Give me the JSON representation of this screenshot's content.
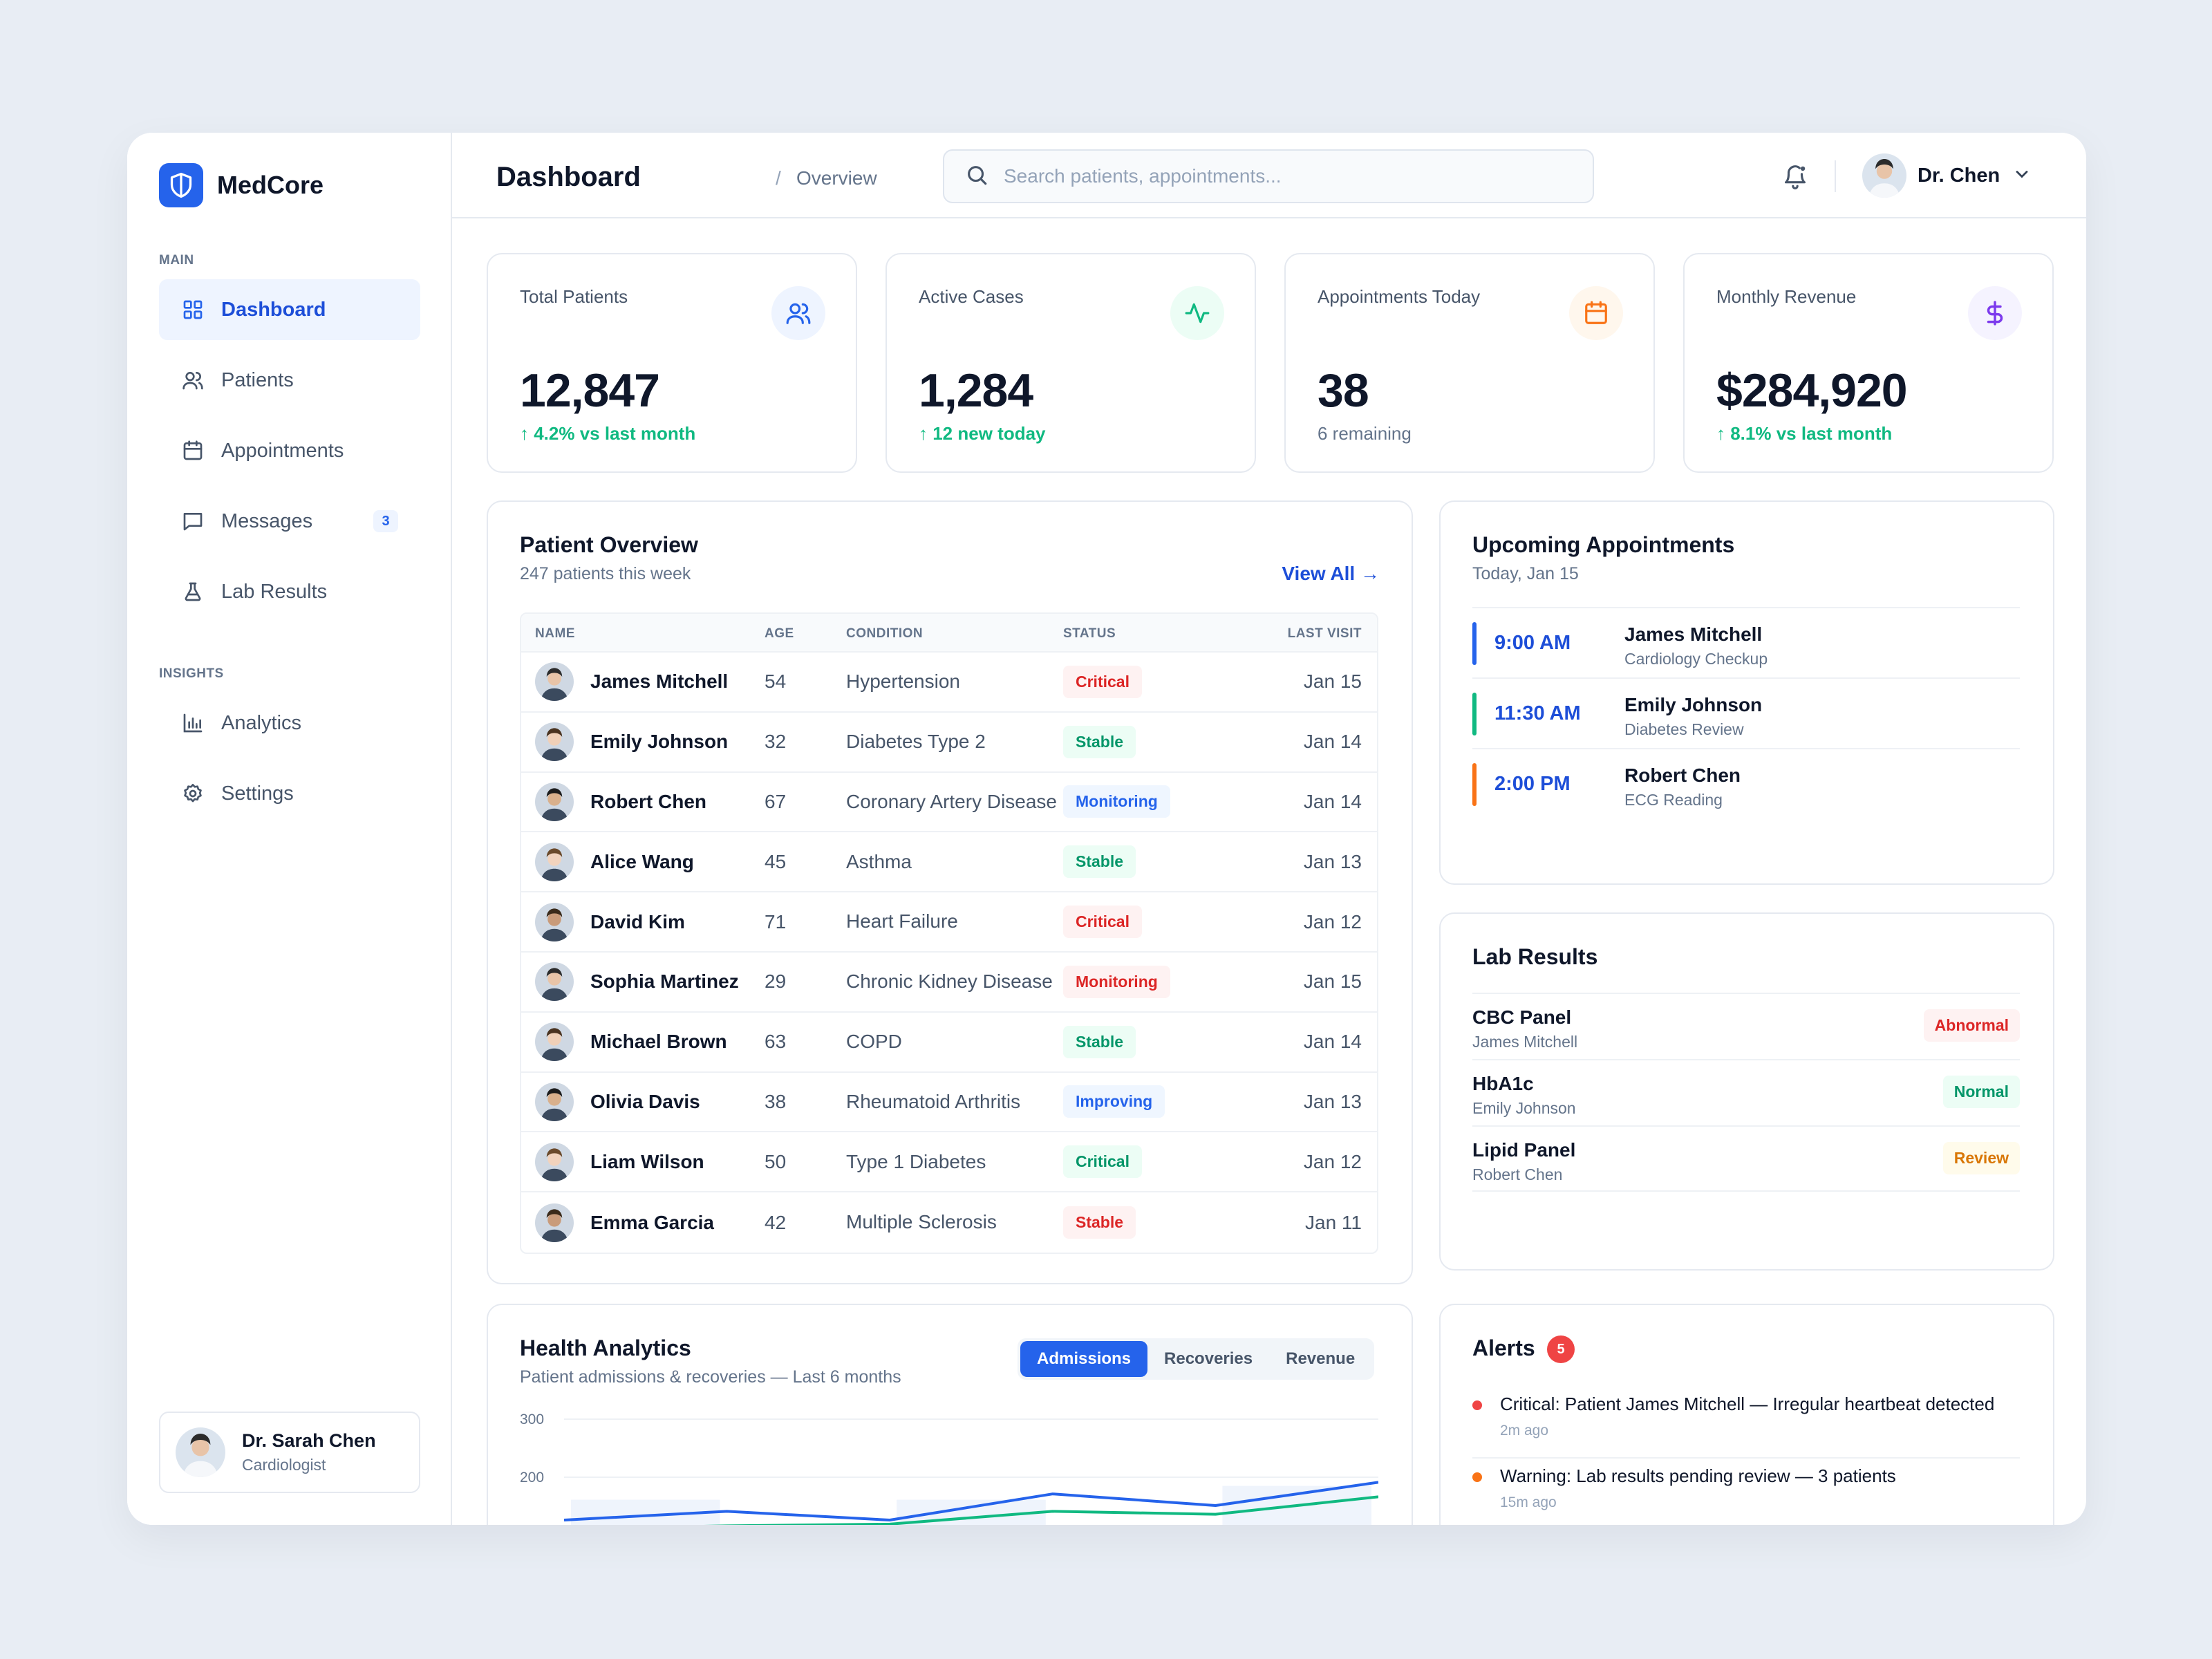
{
  "app": {
    "name": "MedCore"
  },
  "sidebar": {
    "main_label": "MAIN",
    "insights_label": "INSIGHTS",
    "items": [
      {
        "label": "Dashboard",
        "icon": "grid-icon"
      },
      {
        "label": "Patients",
        "icon": "users-icon"
      },
      {
        "label": "Appointments",
        "icon": "calendar-icon"
      },
      {
        "label": "Messages",
        "icon": "message-icon",
        "badge": "3"
      },
      {
        "label": "Lab Results",
        "icon": "flask-icon"
      },
      {
        "label": "Analytics",
        "icon": "bar-chart-icon"
      },
      {
        "label": "Settings",
        "icon": "gear-icon"
      }
    ],
    "user": {
      "name": "Dr. Sarah Chen",
      "role": "Cardiologist"
    }
  },
  "header": {
    "title": "Dashboard",
    "separator": "/",
    "subtitle": "Overview",
    "search_placeholder": "Search patients, appointments...",
    "profile_name": "Dr. Chen"
  },
  "stats": [
    {
      "label": "Total Patients",
      "value": "12,847",
      "sub": "↑ 4.2% vs last month",
      "icon": "users-icon",
      "color": "#2563eb"
    },
    {
      "label": "Active Cases",
      "value": "1,284",
      "sub": "↑ 12 new today",
      "icon": "activity-icon",
      "color": "#10b981"
    },
    {
      "label": "Appointments Today",
      "value": "38",
      "sub": "6 remaining",
      "icon": "calendar-icon",
      "color": "#f97316"
    },
    {
      "label": "Monthly Revenue",
      "value": "$284,920",
      "sub": "↑ 8.1% vs last month",
      "icon": "dollar-icon",
      "color": "#7c3aed"
    }
  ],
  "patients": {
    "title": "Patient Overview",
    "subtitle": "247 patients this week",
    "view_all": "View All →",
    "columns": [
      "NAME",
      "AGE",
      "CONDITION",
      "STATUS",
      "LAST VISIT"
    ],
    "rows": [
      {
        "name": "James Mitchell",
        "age": "54",
        "condition": "Hypertension",
        "status": "Critical",
        "last": "Jan 15",
        "tone": "red"
      },
      {
        "name": "Emily Johnson",
        "age": "32",
        "condition": "Diabetes Type 2",
        "status": "Stable",
        "last": "Jan 14",
        "tone": "green"
      },
      {
        "name": "Robert Chen",
        "age": "67",
        "condition": "Coronary Artery Disease",
        "status": "Monitoring",
        "last": "Jan 14",
        "tone": "blue"
      },
      {
        "name": "Alice Wang",
        "age": "45",
        "condition": "Asthma",
        "status": "Stable",
        "last": "Jan 13",
        "tone": "green"
      },
      {
        "name": "David Kim",
        "age": "71",
        "condition": "Heart Failure",
        "status": "Critical",
        "last": "Jan 12",
        "tone": "red"
      },
      {
        "name": "Sophia Martinez",
        "age": "29",
        "condition": "Chronic Kidney Disease",
        "status": "Monitoring",
        "last": "Jan 15",
        "tone": "red"
      },
      {
        "name": "Michael Brown",
        "age": "63",
        "condition": "COPD",
        "status": "Stable",
        "last": "Jan 14",
        "tone": "green"
      },
      {
        "name": "Olivia Davis",
        "age": "38",
        "condition": "Rheumatoid Arthritis",
        "status": "Improving",
        "last": "Jan 13",
        "tone": "blue"
      },
      {
        "name": "Liam Wilson",
        "age": "50",
        "condition": "Type 1 Diabetes",
        "status": "Critical",
        "last": "Jan 12",
        "tone": "green"
      },
      {
        "name": "Emma Garcia",
        "age": "42",
        "condition": "Multiple Sclerosis",
        "status": "Stable",
        "last": "Jan 11",
        "tone": "red"
      }
    ]
  },
  "appointments": {
    "title": "Upcoming Appointments",
    "subtitle": "Today, Jan 15",
    "items": [
      {
        "time": "9:00 AM",
        "name": "James Mitchell",
        "type": "Cardiology Checkup",
        "color": "#2563eb"
      },
      {
        "time": "11:30 AM",
        "name": "Emily Johnson",
        "type": "Diabetes Review",
        "color": "#10b981"
      },
      {
        "time": "2:00 PM",
        "name": "Robert Chen",
        "type": "ECG Reading",
        "color": "#f97316"
      }
    ]
  },
  "labs": {
    "title": "Lab Results",
    "items": [
      {
        "test": "CBC Panel",
        "patient": "James Mitchell",
        "result": "Abnormal",
        "tone": "red"
      },
      {
        "test": "HbA1c",
        "patient": "Emily Johnson",
        "result": "Normal",
        "tone": "green"
      },
      {
        "test": "Lipid Panel",
        "patient": "Robert Chen",
        "result": "Review",
        "tone": "amber"
      }
    ]
  },
  "analytics": {
    "title": "Health Analytics",
    "subtitle": "Patient admissions & recoveries — Last 6 months",
    "tabs": [
      "Admissions",
      "Recoveries",
      "Revenue"
    ],
    "y_ticks": [
      "300",
      "200"
    ]
  },
  "alerts": {
    "title": "Alerts",
    "count": "5",
    "items": [
      {
        "text": "Critical: Patient James Mitchell — Irregular heartbeat detected",
        "ago": "2m ago",
        "color": "#ef4444"
      },
      {
        "text": "Warning: Lab results pending review — 3 patients",
        "ago": "15m ago",
        "color": "#f97316"
      }
    ]
  },
  "chart_data": {
    "type": "line",
    "title": "",
    "categories": [
      "",
      "",
      "",
      "",
      "",
      ""
    ],
    "series": [
      {
        "name": "Admissions",
        "values": [
          125,
          140,
          125,
          170,
          150,
          190
        ],
        "color": "#2563eb"
      },
      {
        "name": "Recoveries",
        "values": [
          110,
          115,
          118,
          140,
          135,
          165
        ],
        "color": "#10b981"
      }
    ],
    "ylim": [
      100,
      300
    ],
    "grid": true
  }
}
